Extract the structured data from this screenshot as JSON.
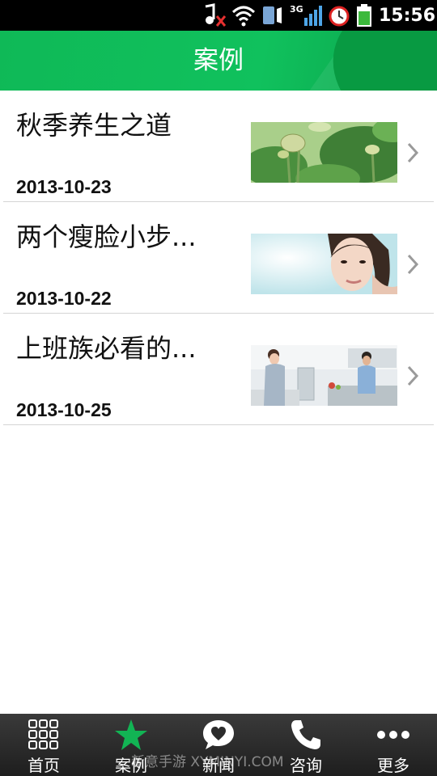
{
  "status_bar": {
    "time": "15:56",
    "network": "3G",
    "icons": [
      "music-muted-icon",
      "wifi-icon",
      "vibrate-icon",
      "signal-icon",
      "alarm-icon",
      "battery-icon"
    ]
  },
  "header": {
    "title": "案例",
    "accent_color": "#10c15d"
  },
  "cases": [
    {
      "title": "秋季养生之道",
      "date": "2013-10-23",
      "image": "lotus-leaves-photo"
    },
    {
      "title": "两个瘦脸小步...",
      "date": "2013-10-22",
      "image": "woman-face-photo"
    },
    {
      "title": "上班族必看的...",
      "date": "2013-10-25",
      "image": "kitchen-couple-photo"
    }
  ],
  "tab_bar": {
    "tabs": [
      {
        "label": "首页",
        "icon": "grid-icon",
        "active": false
      },
      {
        "label": "案例",
        "icon": "star-icon",
        "active": true
      },
      {
        "label": "新闻",
        "icon": "heart-bubble-icon",
        "active": false
      },
      {
        "label": "咨询",
        "icon": "phone-icon",
        "active": false
      },
      {
        "label": "更多",
        "icon": "more-dots-icon",
        "active": false
      }
    ]
  },
  "watermark": "新意手游 XYMINYI.COM"
}
